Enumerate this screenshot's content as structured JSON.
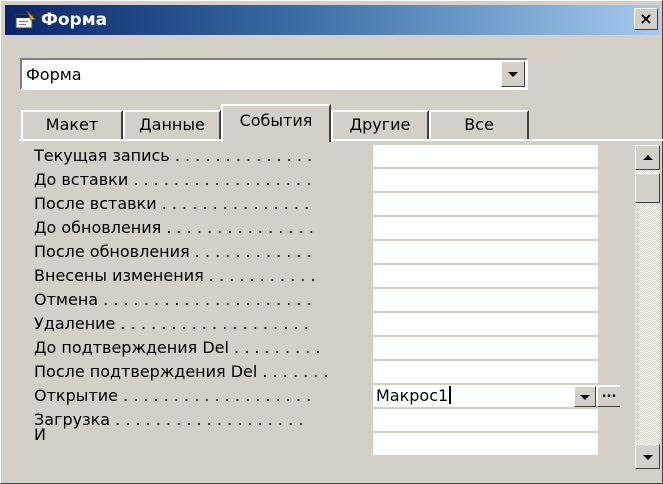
{
  "window": {
    "title": "Форма",
    "icon": "form-properties-icon",
    "close_label": "×"
  },
  "object_selector": {
    "value": "Форма"
  },
  "tabs": [
    {
      "label": "Макет"
    },
    {
      "label": "Данные"
    },
    {
      "label": "События",
      "active": true
    },
    {
      "label": "Другие"
    },
    {
      "label": "Все"
    }
  ],
  "properties": [
    {
      "label": "Текущая запись . . . . . . . . . . . . . .",
      "value": ""
    },
    {
      "label": "До вставки . . . . . . . . . . . . . . . . . .",
      "value": ""
    },
    {
      "label": "После вставки . . . . . . . . . . . . . . .",
      "value": ""
    },
    {
      "label": "До обновления . . . . . . . . . . . . . . .",
      "value": ""
    },
    {
      "label": "После обновления . . . . . . . . . . . .",
      "value": ""
    },
    {
      "label": "Внесены изменения . . . . . . . . . . .",
      "value": ""
    },
    {
      "label": "Отмена . . . . . . . . . . . . . . . . . . . . .",
      "value": ""
    },
    {
      "label": "Удаление . . . . . . . . . . . . . . . . . . .",
      "value": ""
    },
    {
      "label": "До подтверждения Del . . . . . . . . .",
      "value": ""
    },
    {
      "label": "После подтверждения Del . . . . . . .",
      "value": ""
    },
    {
      "label": "Открытие . . . . . . . . . . . . . . . . . . .",
      "value": "Макрос1",
      "active": true,
      "builder_label": "..."
    },
    {
      "label": "Загрузка . . . . . . . . . . . . . . . . . . .",
      "value": ""
    },
    {
      "label": "И",
      "value": ""
    }
  ]
}
